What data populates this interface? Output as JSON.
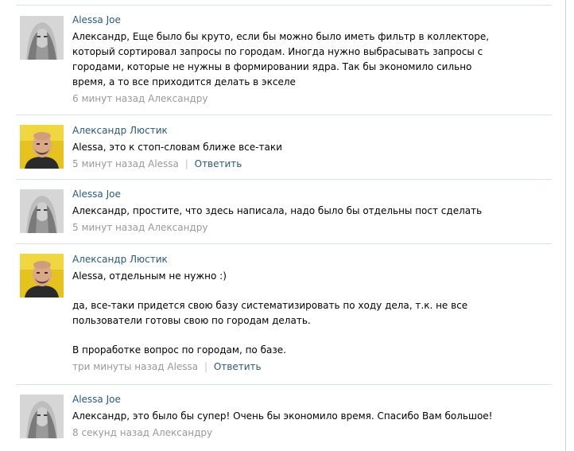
{
  "comments": [
    {
      "author": "Alessa Joe",
      "text": "Александр, Еще было бы круто, если бы можно было иметь фильтр в коллекторе, который сортировал запросы по городам. Иногда нужно выбрасывать запросы с городами, которые не нужны в формировании ядра. Так бы экономило сильно время, а то все приходится делать в экселе",
      "time": "6 минут назад",
      "reply_to": "Александру"
    },
    {
      "author": "Александр Люстик",
      "text": "Alessa, это к стоп-словам ближе все-таки",
      "time": "5 минут назад",
      "reply_to": "Alessa",
      "reply_label": "Ответить"
    },
    {
      "author": "Alessa Joe",
      "text": "Александр, простите, что здесь написала, надо было бы отдельны пост сделать",
      "time": "5 минут назад",
      "reply_to": "Александру"
    },
    {
      "author": "Александр Люстик",
      "text_line1": "Alessa, отдельным не нужно :)",
      "text_line2": "да, все-таки придется свою базу систематизировать по ходу дела, т.к. не все пользователи готовы свою по городам делать.",
      "text_line3": "В проработке вопрос по городам, по базе.",
      "time": "три минуты назад",
      "reply_to": "Alessa",
      "reply_label": "Ответить"
    },
    {
      "author": "Alessa Joe",
      "text": "Александр, это было бы супер! Очень бы экономило время. Спасибо Вам большое!",
      "time": "8 секунд назад",
      "reply_to": "Александру"
    }
  ],
  "colors": {
    "link": "#2b587a",
    "meta": "#999999",
    "divider": "#dae1e8"
  },
  "icons": {
    "alessa_avatar": "grayscale-portrait-avatar",
    "alexander_avatar": "bald-man-yellow-background-avatar"
  }
}
